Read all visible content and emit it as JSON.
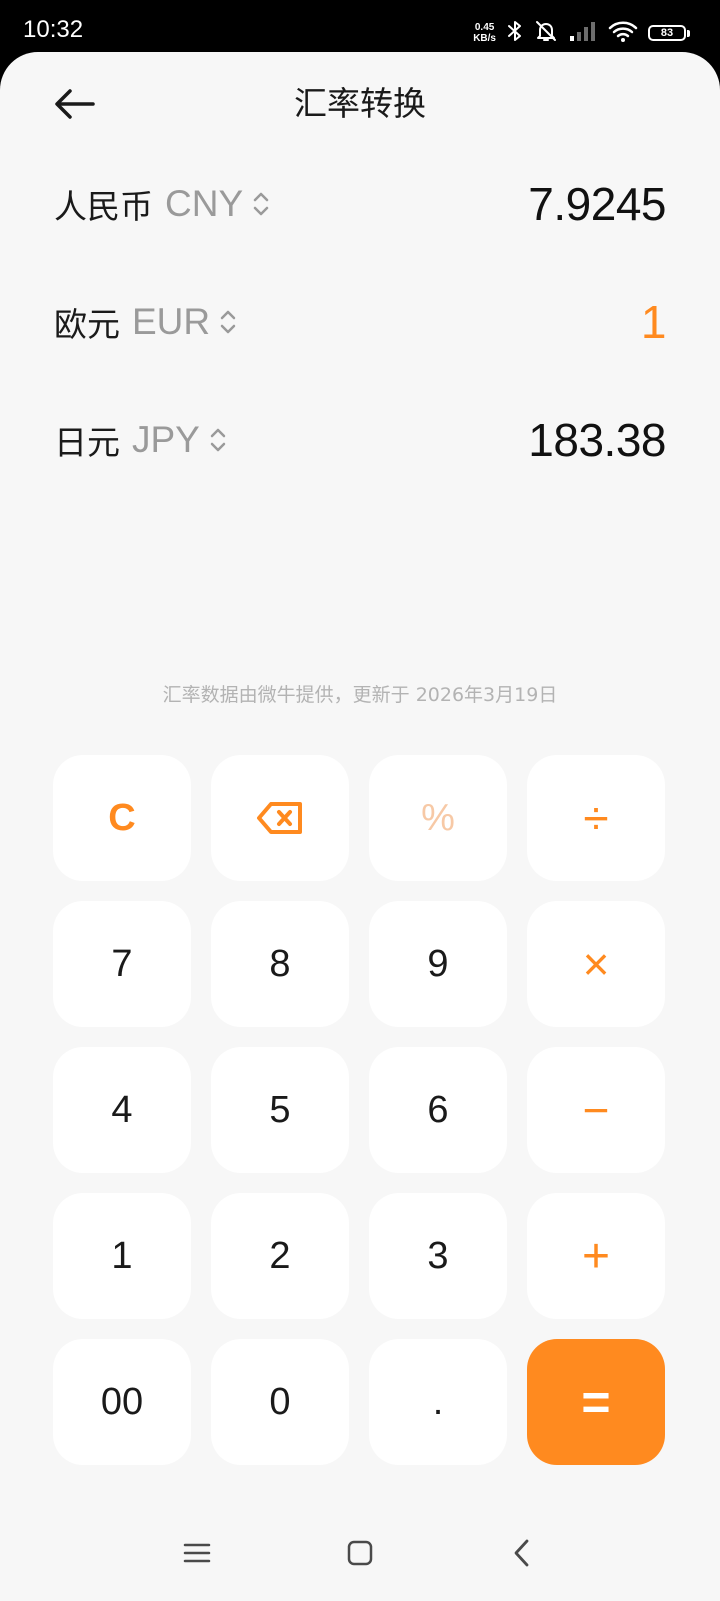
{
  "status_bar": {
    "time": "10:32",
    "net_speed_value": "0.45",
    "net_speed_unit": "KB/s",
    "battery_level": "83",
    "icons": [
      "bluetooth-icon",
      "alarm-off-icon",
      "signal-icon",
      "wifi-icon",
      "battery-icon"
    ]
  },
  "header": {
    "title": "汇率转换",
    "back_icon": "arrow-left-icon"
  },
  "currencies": [
    {
      "name": "人民币",
      "code": "CNY",
      "value": "7.9245",
      "active": false
    },
    {
      "name": "欧元",
      "code": "EUR",
      "value": "1",
      "active": true
    },
    {
      "name": "日元",
      "code": "JPY",
      "value": "183.38",
      "active": false
    }
  ],
  "source_note": "汇率数据由微牛提供，更新于 2026年3月19日",
  "keypad": {
    "clear": "C",
    "backspace_icon": "backspace-icon",
    "percent": "%",
    "divide": "÷",
    "digits": {
      "seven": "7",
      "eight": "8",
      "nine": "9",
      "four": "4",
      "five": "5",
      "six": "6",
      "one": "1",
      "two": "2",
      "three": "3",
      "double_zero": "00",
      "zero": "0",
      "decimal": "."
    },
    "multiply": "×",
    "minus": "−",
    "plus": "+",
    "equals": "="
  },
  "nav_bar": {
    "icons": [
      "menu-icon",
      "home-icon",
      "back-icon"
    ]
  },
  "colors": {
    "accent": "#ff8a1f",
    "background": "#f7f7f7",
    "key_background": "#ffffff",
    "muted_text": "#9a9a9a"
  }
}
